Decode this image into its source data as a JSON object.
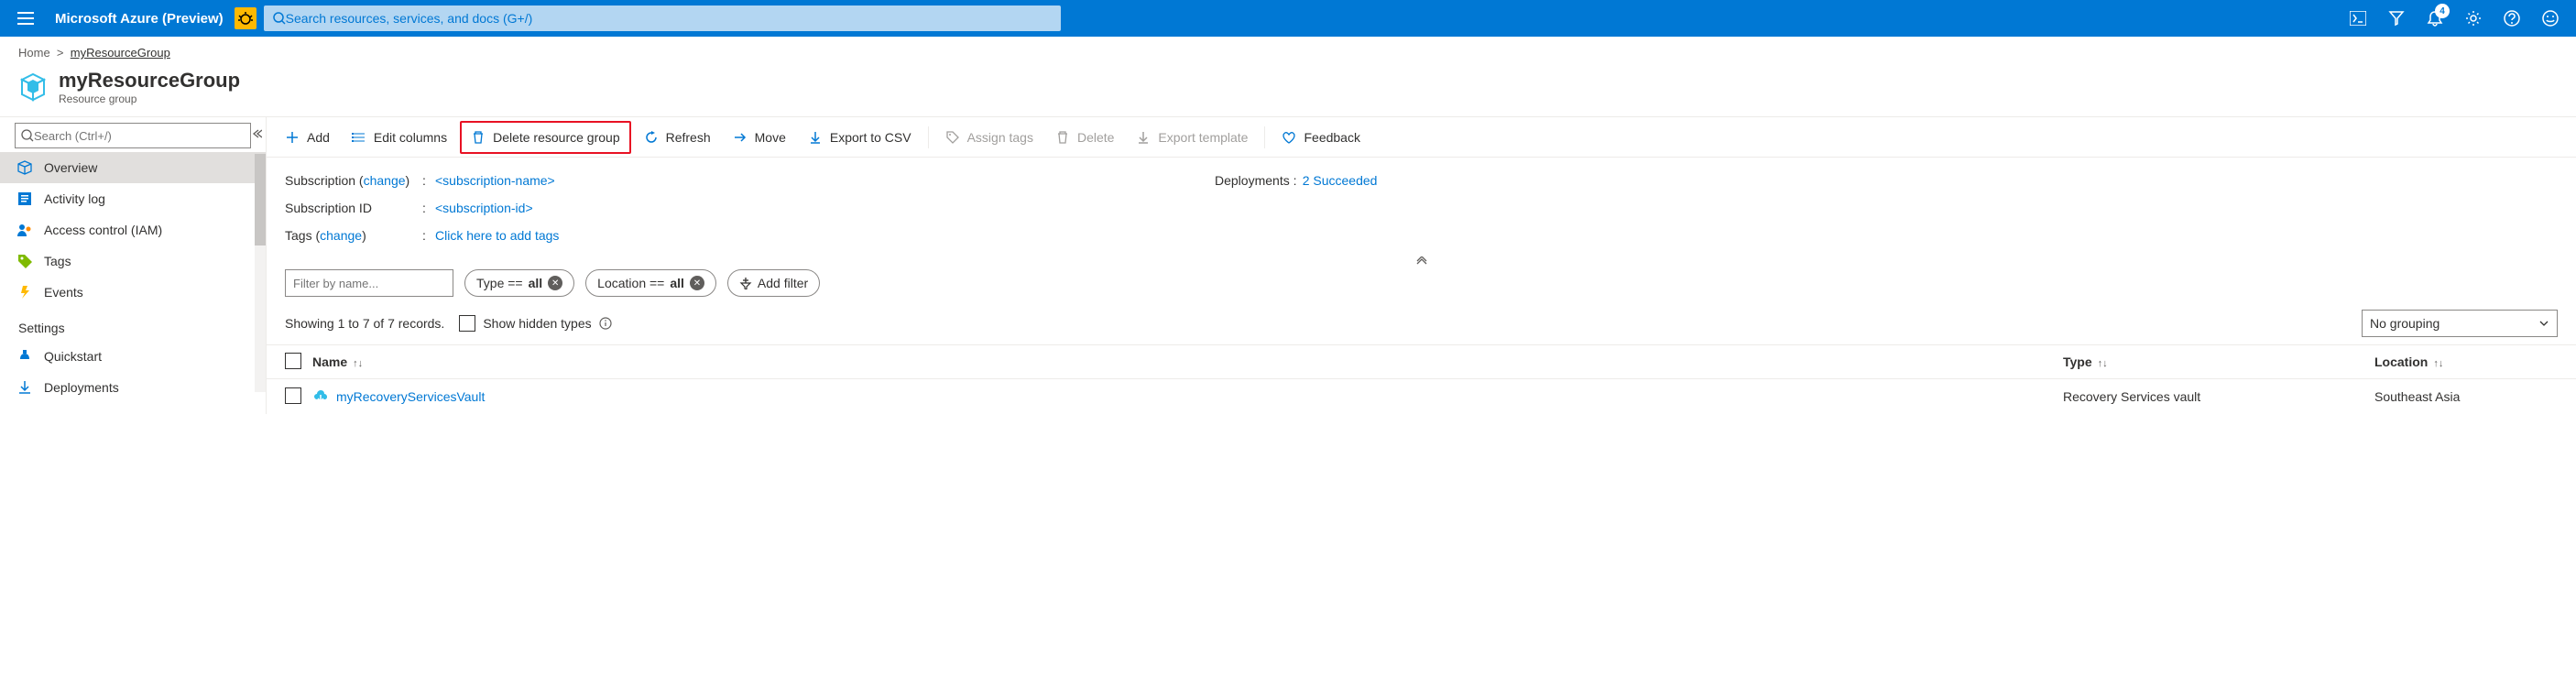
{
  "header": {
    "brand": "Microsoft Azure (Preview)",
    "search_placeholder": "Search resources, services, and docs (G+/)",
    "notification_count": "4"
  },
  "breadcrumb": {
    "home": "Home",
    "current": "myResourceGroup"
  },
  "page": {
    "title": "myResourceGroup",
    "subtitle": "Resource group"
  },
  "sidebar": {
    "search_placeholder": "Search (Ctrl+/)",
    "items": [
      {
        "label": "Overview",
        "icon": "cube"
      },
      {
        "label": "Activity log",
        "icon": "activity"
      },
      {
        "label": "Access control (IAM)",
        "icon": "iam"
      },
      {
        "label": "Tags",
        "icon": "tags"
      },
      {
        "label": "Events",
        "icon": "events"
      }
    ],
    "settings_header": "Settings",
    "settings_items": [
      {
        "label": "Quickstart",
        "icon": "quickstart"
      },
      {
        "label": "Deployments",
        "icon": "deployments"
      }
    ]
  },
  "commands": {
    "add": "Add",
    "edit_columns": "Edit columns",
    "delete_rg": "Delete resource group",
    "refresh": "Refresh",
    "move": "Move",
    "export_csv": "Export to CSV",
    "assign_tags": "Assign tags",
    "delete": "Delete",
    "export_template": "Export template",
    "feedback": "Feedback"
  },
  "essentials": {
    "subscription_label": "Subscription",
    "subscription_value": "<subscription-name>",
    "subscription_id_label": "Subscription ID",
    "subscription_id_value": "<subscription-id>",
    "tags_label": "Tags",
    "tags_value": "Click here to add tags",
    "change": "change",
    "deployments_label": "Deployments",
    "deployments_value": "2 Succeeded"
  },
  "filters": {
    "placeholder": "Filter by name...",
    "type_label": "Type == ",
    "type_val": "all",
    "location_label": "Location == ",
    "location_val": "all",
    "add_filter": "Add filter"
  },
  "records": {
    "showing": "Showing 1 to 7 of 7 records.",
    "hidden_types": "Show hidden types",
    "grouping": "No grouping"
  },
  "table": {
    "headers": {
      "name": "Name",
      "type": "Type",
      "location": "Location"
    },
    "rows": [
      {
        "name": "myRecoveryServicesVault",
        "type": "Recovery Services vault",
        "location": "Southeast Asia"
      }
    ]
  }
}
